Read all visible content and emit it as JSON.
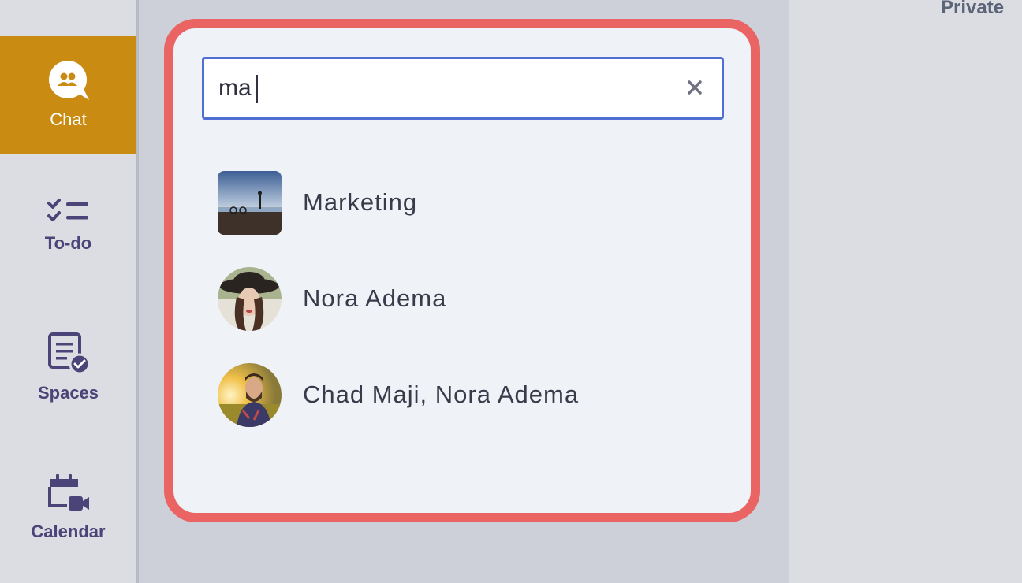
{
  "nav": {
    "items": [
      {
        "label": "Chat",
        "icon": "chat-icon",
        "active": true
      },
      {
        "label": "To-do",
        "icon": "todo-icon",
        "active": false
      },
      {
        "label": "Spaces",
        "icon": "spaces-icon",
        "active": false
      },
      {
        "label": "Calendar",
        "icon": "calendar-icon",
        "active": false
      }
    ]
  },
  "right_panel": {
    "heading": "Private"
  },
  "search": {
    "value": "ma",
    "clear_icon": "close-icon"
  },
  "results": [
    {
      "name": "Marketing",
      "avatar": "group-photo-avatar"
    },
    {
      "name": "Nora Adema",
      "avatar": "user-photo-avatar"
    },
    {
      "name": "Chad Maji, Nora Adema",
      "avatar": "user-photo-avatar"
    }
  ],
  "colors": {
    "accent": "#c98b12",
    "highlight_border": "#ea6464",
    "focus_border": "#4f6fd4",
    "nav_text": "#4b4478"
  }
}
